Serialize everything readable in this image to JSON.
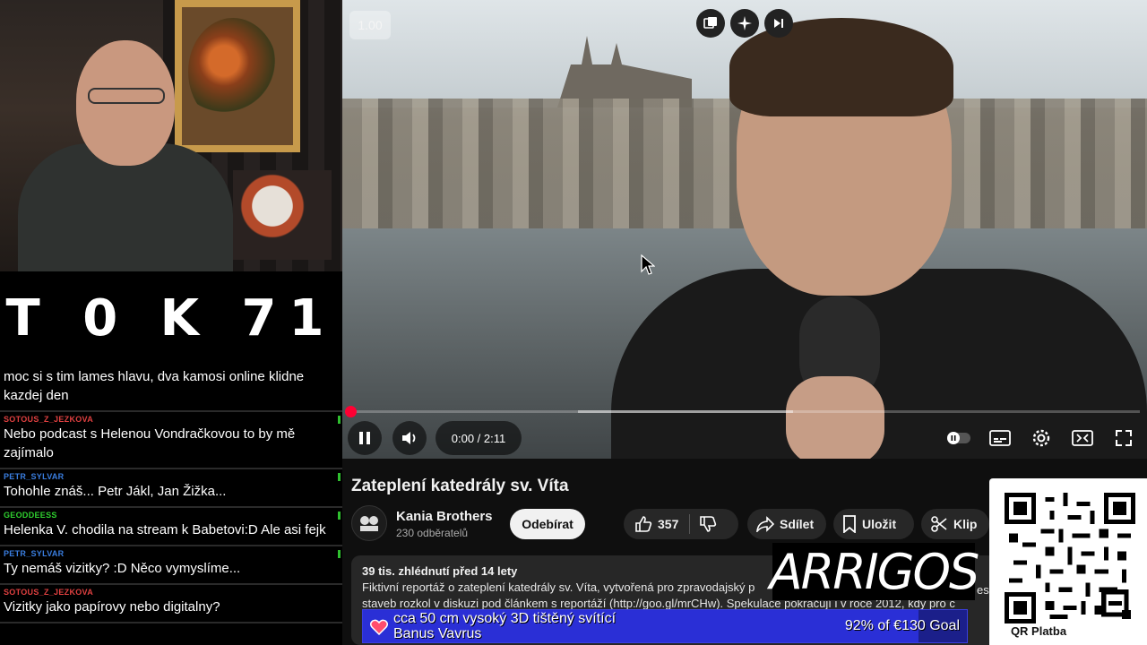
{
  "webcam": {
    "description_icon": "webcam-feed"
  },
  "counter": {
    "text": "T 0  K 71"
  },
  "chat": {
    "messages": [
      {
        "user": "",
        "text": "moc si s tim lames hlavu, dva kamosi online klidne kazdej den",
        "user_color": "#e04040"
      },
      {
        "user": "SOTOUS_Z_JEZKOVA",
        "text": "Nebo podcast s Helenou Vondračkovou to by mě zajímalo",
        "user_color": "#e04040"
      },
      {
        "user": "PETR_SYLVAR",
        "text": "Tohohle znáš... Petr Jákl, Jan Žižka...",
        "user_color": "#3a7ee0"
      },
      {
        "user": "GEODDEESS",
        "text": "Helenka V. chodila na stream k Babetovi:D Ale asi fejk",
        "user_color": "#2fd02f"
      },
      {
        "user": "PETR_SYLVAR",
        "text": "Ty nemáš vizitky? :D Něco vymyslíme...",
        "user_color": "#3a7ee0"
      },
      {
        "user": "SOTOUS_Z_JEZKOVA",
        "text": "Vizitky jako papírovy nebo digitalny?",
        "user_color": "#e04040"
      }
    ]
  },
  "player": {
    "speed": "1.00",
    "time": "0:00 / 2:11",
    "progress_fraction": 0.0,
    "buffered_fraction_start": 0.29,
    "buffered_fraction_end": 0.56,
    "accent": "#ff0033"
  },
  "video": {
    "title": "Zateplení katedrály sv. Víta",
    "channel": "Kania Brothers",
    "subscribers": "230 odběratelů",
    "subscribe_label": "Odebírat",
    "likes": "357",
    "share_label": "Sdílet",
    "save_label": "Uložit",
    "clip_label": "Klip",
    "description_meta": "39 tis. zhlédnutí  před 14 lety",
    "description_line1": "Fiktivní reportáž o zateplení katedrály sv. Víta, vytvořená pro zpravodajský p",
    "description_line1_tail": "es",
    "description_line2": "staveb rozkol v diskuzi pod článkem s reportáží (http://goo.gl/mrCHw). Spekulace pokračují i v roce 2012, kdy pro c"
  },
  "brand": {
    "text": "ARRIGOS"
  },
  "qr": {
    "label": "QR Platba"
  },
  "goal": {
    "text_line1": "cca 50 cm vysoký 3D tištěný svítící",
    "text_line2": "Banus Vavrus",
    "percent_text": "92% of €130 Goal",
    "fraction": 0.92,
    "color": "#2a2fd6"
  }
}
